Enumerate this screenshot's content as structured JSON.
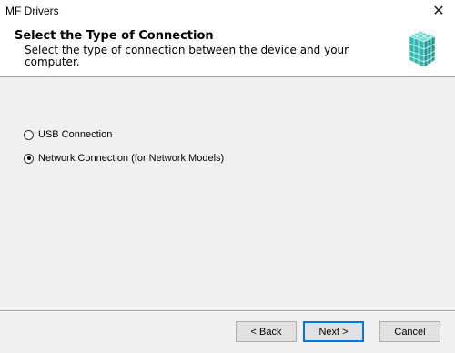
{
  "window": {
    "title": "MF Drivers"
  },
  "header": {
    "title": "Select the Type of Connection",
    "subtitle": "Select the type of connection between the device and your computer."
  },
  "options": [
    {
      "label": "USB Connection",
      "selected": false
    },
    {
      "label": "Network Connection (for Network Models)",
      "selected": true
    }
  ],
  "buttons": {
    "back": "< Back",
    "next": "Next >",
    "cancel": "Cancel"
  },
  "colors": {
    "logo_teal": "#2fb7b0",
    "default_button_border": "#0078d7"
  },
  "icons": {
    "close": "close-icon",
    "logo": "canon-cube-logo-icon"
  }
}
